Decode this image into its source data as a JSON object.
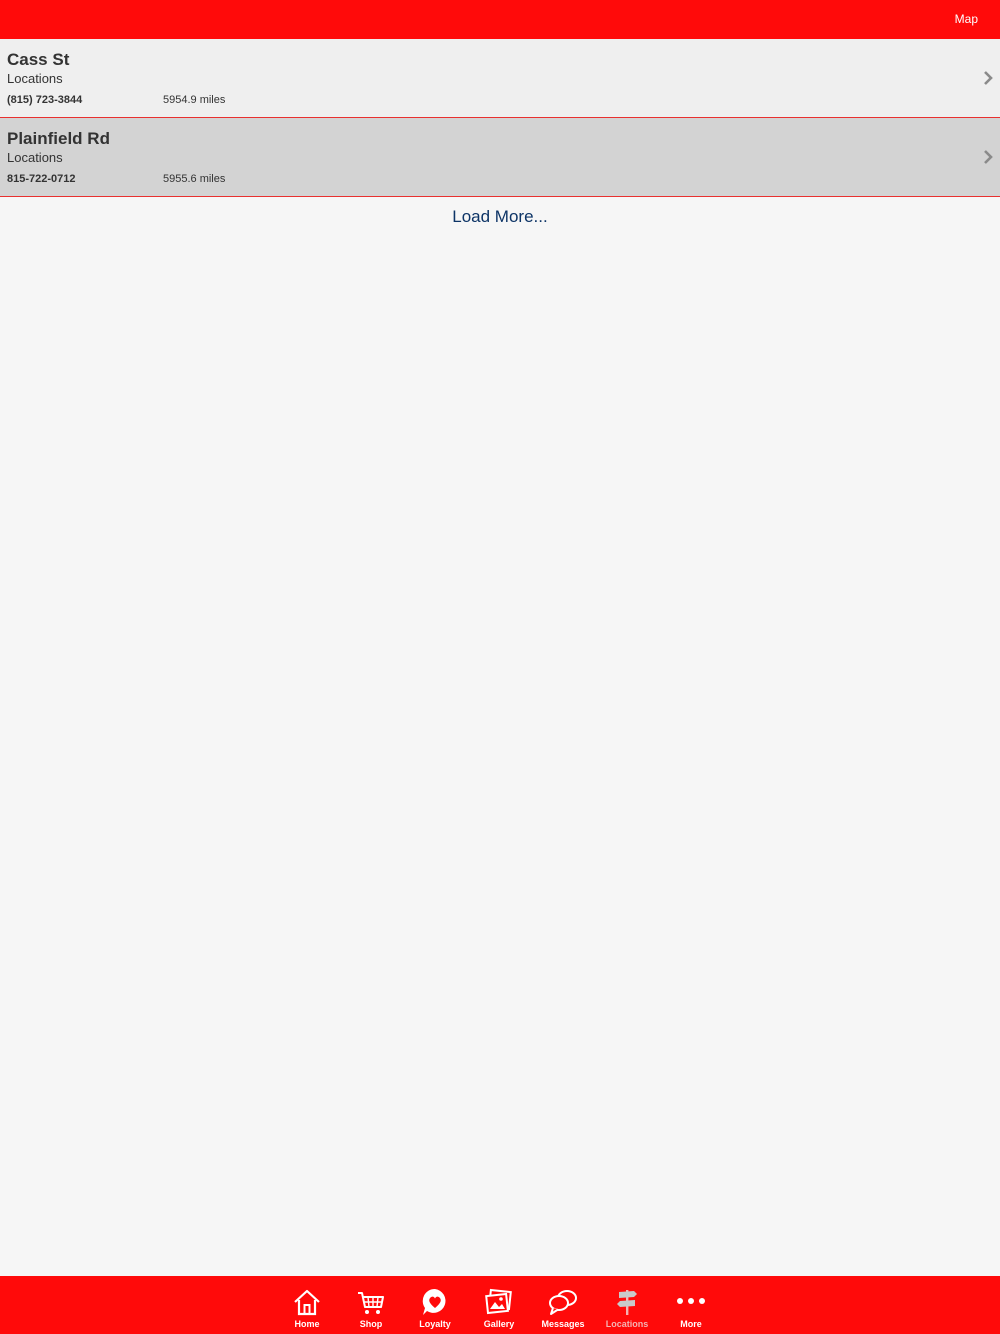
{
  "header": {
    "map_label": "Map"
  },
  "locations": [
    {
      "name": "Cass St",
      "category": "Locations",
      "phone": "(815) 723-3844",
      "distance": "5954.9 miles"
    },
    {
      "name": "Plainfield Rd",
      "category": "Locations",
      "phone": "815-722-0712",
      "distance": "5955.6 miles"
    }
  ],
  "load_more_label": "Load More...",
  "tabbar": {
    "active": "Locations",
    "items": [
      {
        "label": "Home",
        "icon": "home-icon"
      },
      {
        "label": "Shop",
        "icon": "cart-icon"
      },
      {
        "label": "Loyalty",
        "icon": "heart-icon"
      },
      {
        "label": "Gallery",
        "icon": "gallery-icon"
      },
      {
        "label": "Messages",
        "icon": "messages-icon"
      },
      {
        "label": "Locations",
        "icon": "signpost-icon"
      },
      {
        "label": "More",
        "icon": "more-icon"
      }
    ]
  },
  "colors": {
    "brand_red": "#ff0a0a",
    "link_blue": "#0d3466",
    "divider": "#e8302f"
  }
}
